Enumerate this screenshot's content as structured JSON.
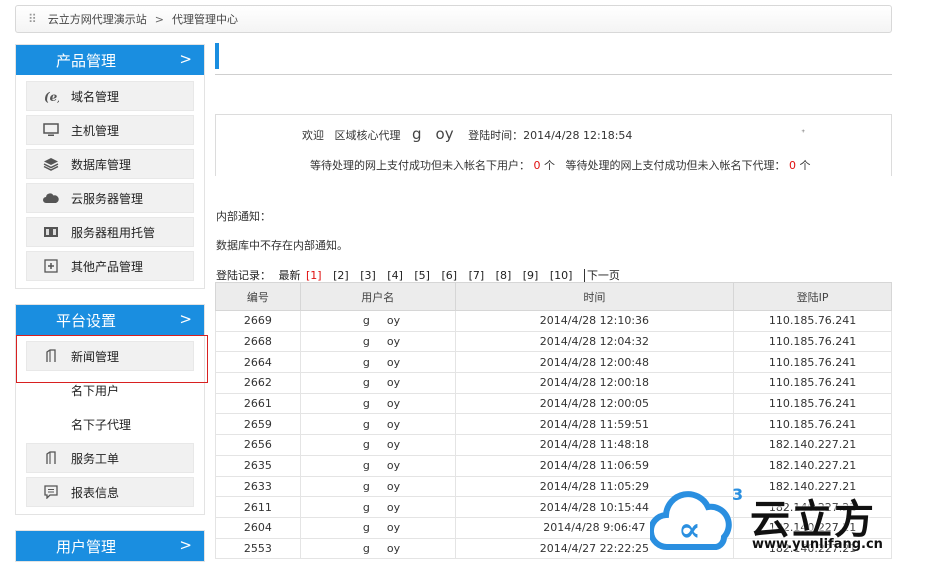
{
  "breadcrumb": {
    "site": "云立方网代理演示站",
    "separator": ">",
    "current": "代理管理中心"
  },
  "sidebar": {
    "product": {
      "title": "产品管理",
      "items": [
        {
          "label": "域名管理",
          "icon": "domain-icon"
        },
        {
          "label": "主机管理",
          "icon": "monitor-icon"
        },
        {
          "label": "数据库管理",
          "icon": "database-layers-icon"
        },
        {
          "label": "云服务器管理",
          "icon": "cloud-icon"
        },
        {
          "label": "服务器租用托管",
          "icon": "server-icon"
        },
        {
          "label": "其他产品管理",
          "icon": "plus-box-icon"
        }
      ]
    },
    "platform": {
      "title": "平台设置",
      "items": [
        {
          "label": "新闻管理",
          "icon": "document-icon"
        },
        {
          "label": "名下用户",
          "icon": ""
        },
        {
          "label": "名下子代理",
          "icon": ""
        },
        {
          "label": "服务工单",
          "icon": "document-icon"
        },
        {
          "label": "报表信息",
          "icon": "chat-icon"
        }
      ]
    },
    "user": {
      "title": "用户管理"
    }
  },
  "welcome": {
    "greet": "欢迎",
    "role": "区域核心代理",
    "name_start": "g",
    "name_end": "oy",
    "login_time_label": "登陆时间：",
    "login_time": "2014/4/28 12:18:54",
    "pending_users_label": "等待处理的网上支付成功但未入帐名下用户：",
    "pending_users_count": "0",
    "pending_agents_label": "等待处理的网上支付成功但未入帐名下代理：",
    "pending_agents_count": "0",
    "unit": "个"
  },
  "notice": {
    "label": "内部通知：",
    "text": "数据库中不存在内部通知。"
  },
  "pager": {
    "label": "登陆记录：",
    "latest": "最新",
    "current": "[1]",
    "pages": [
      "[2]",
      "[3]",
      "[4]",
      "[5]",
      "[6]",
      "[7]",
      "[8]",
      "[9]",
      "[10]"
    ],
    "next": "下一页"
  },
  "login_table": {
    "headers": [
      "编号",
      "用户名",
      "时间",
      "登陆IP"
    ],
    "rows": [
      [
        "2669",
        "g",
        "oy",
        "2014/4/28 12:10:36",
        "110.185.76.241"
      ],
      [
        "2668",
        "g",
        "oy",
        "2014/4/28 12:04:32",
        "110.185.76.241"
      ],
      [
        "2664",
        "g",
        "oy",
        "2014/4/28 12:00:48",
        "110.185.76.241"
      ],
      [
        "2662",
        "g",
        "oy",
        "2014/4/28 12:00:18",
        "110.185.76.241"
      ],
      [
        "2661",
        "g",
        "oy",
        "2014/4/28 12:00:05",
        "110.185.76.241"
      ],
      [
        "2659",
        "g",
        "oy",
        "2014/4/28 11:59:51",
        "110.185.76.241"
      ],
      [
        "2656",
        "g",
        "oy",
        "2014/4/28 11:48:18",
        "182.140.227.21"
      ],
      [
        "2635",
        "g",
        "oy",
        "2014/4/28 11:06:59",
        "182.140.227.21"
      ],
      [
        "2633",
        "g",
        "oy",
        "2014/4/28 11:05:29",
        "182.140.227.21"
      ],
      [
        "2611",
        "g",
        "oy",
        "2014/4/28 10:15:44",
        "182.140.227.21"
      ],
      [
        "2604",
        "g",
        "oy",
        "2014/4/28 9:06:47",
        "182.140.227.21"
      ],
      [
        "2553",
        "g",
        "oy",
        "2014/4/27 22:22:25",
        "182.140.227.21"
      ]
    ]
  },
  "watermark": {
    "brand": "云立方",
    "url": "www.yunlifang.cn",
    "superscript": "3"
  },
  "colors": {
    "accent": "#1a8ee0",
    "alert": "#e01010",
    "highlight_border": "#d82020"
  }
}
